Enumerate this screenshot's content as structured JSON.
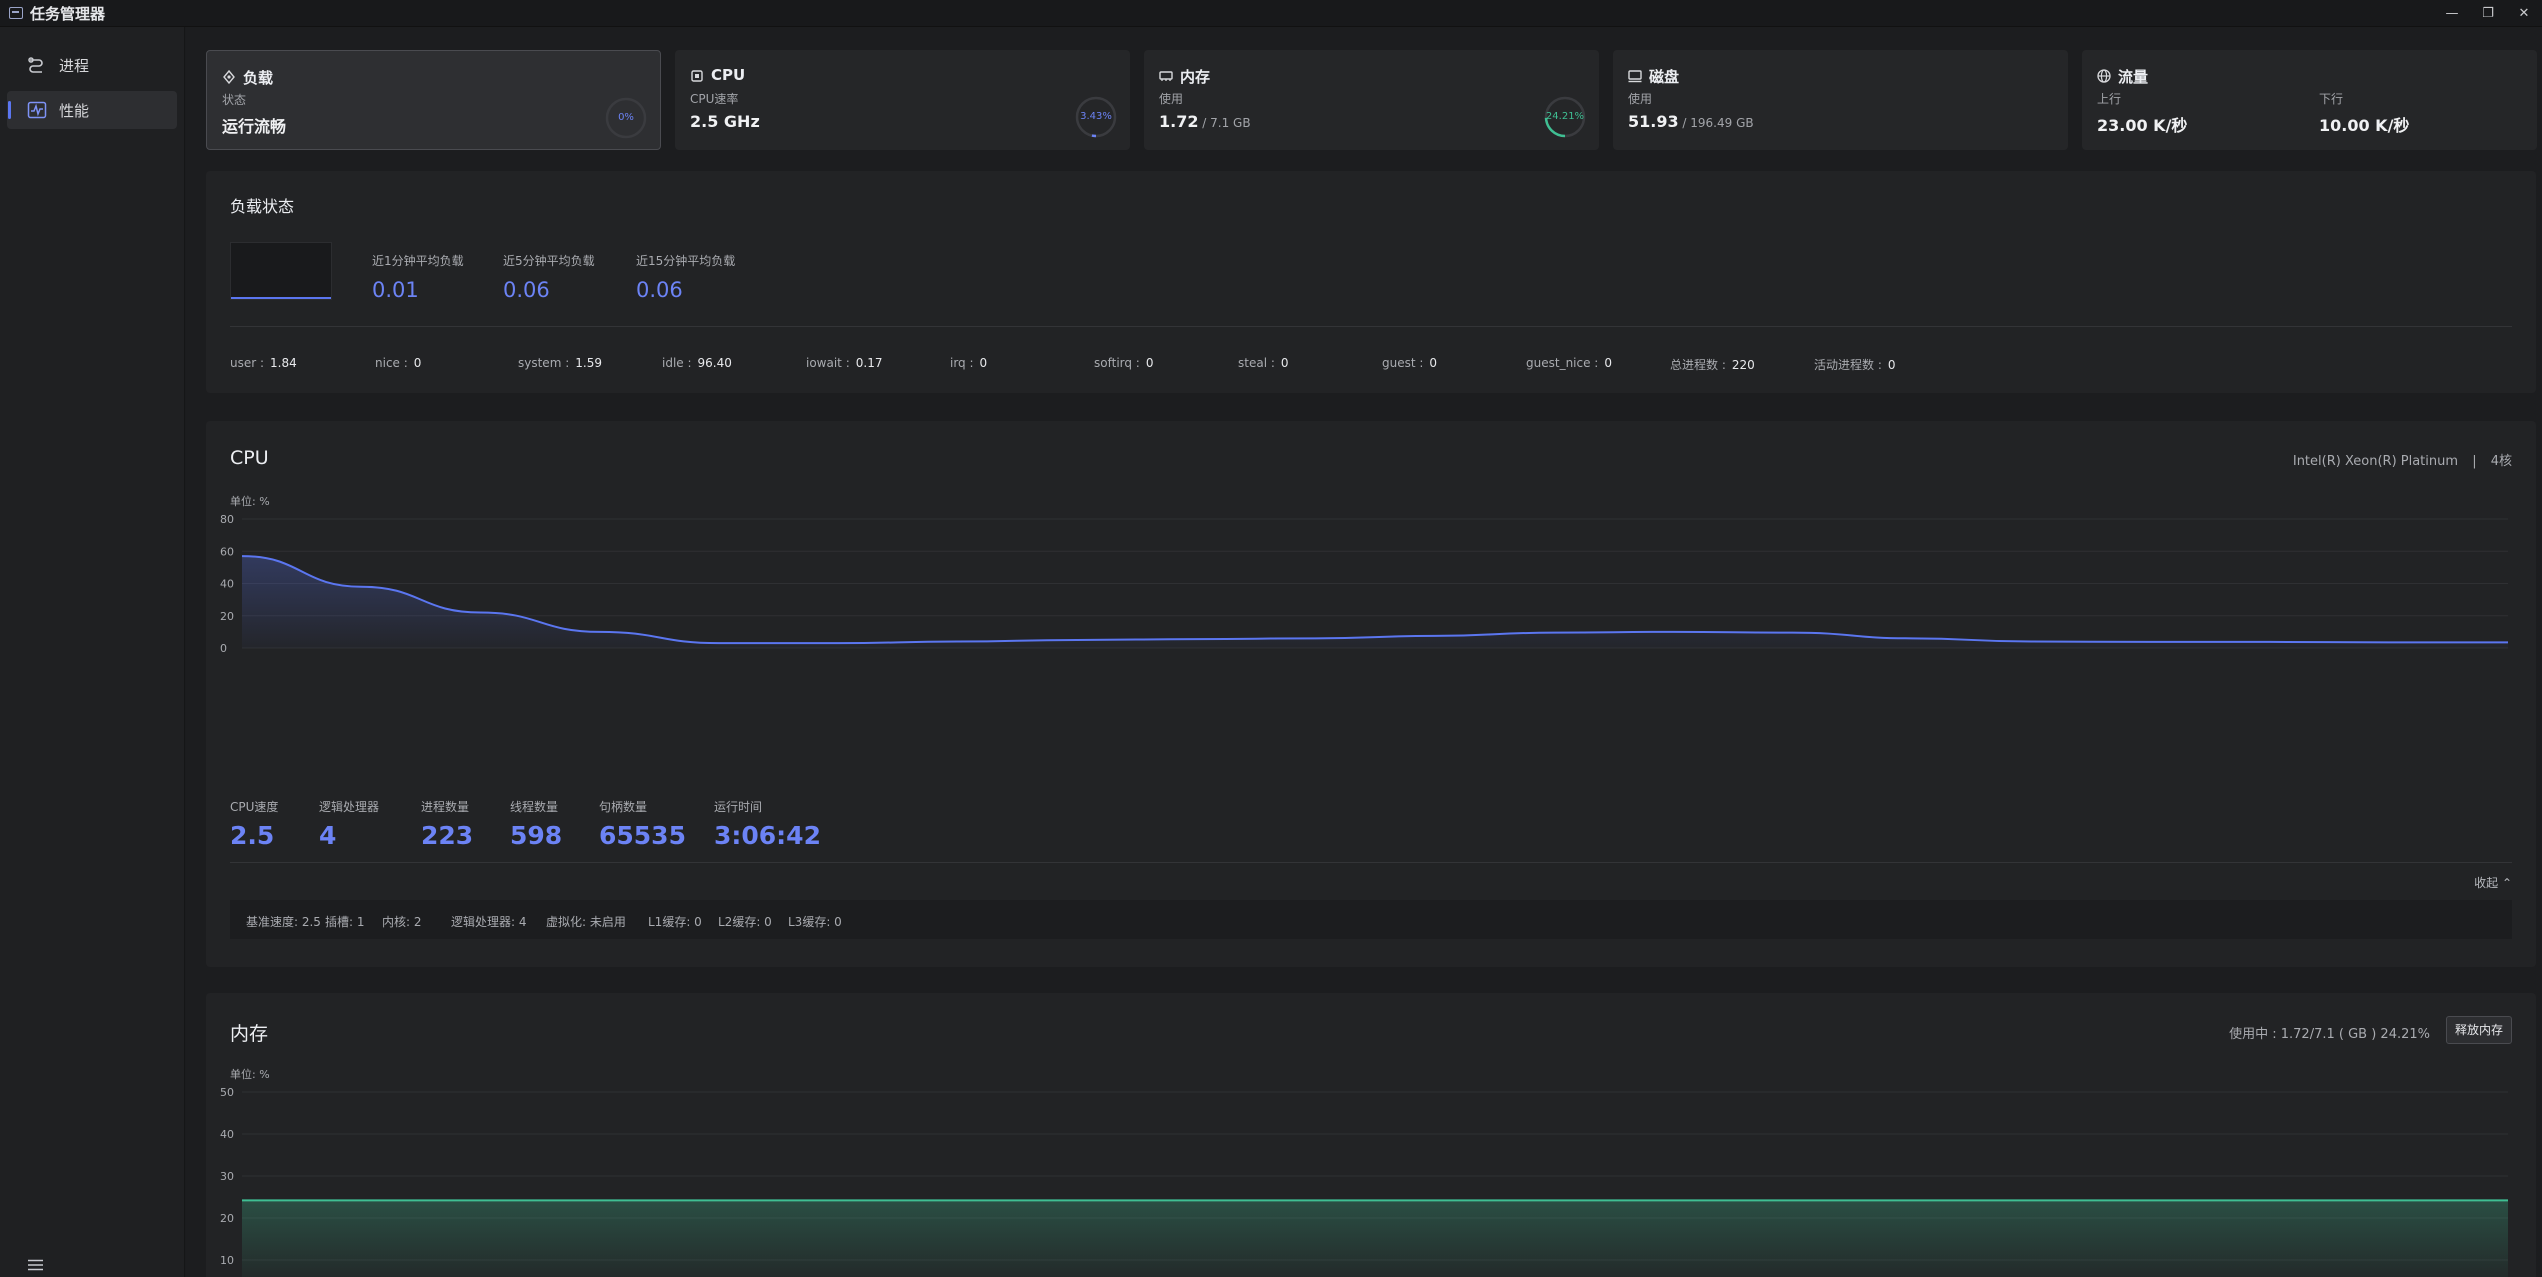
{
  "window": {
    "title": "任务管理器",
    "controls": [
      "—",
      "❐",
      "✕"
    ]
  },
  "sidebar": {
    "items": [
      {
        "label": "进程",
        "icon": "process-icon",
        "active": false
      },
      {
        "label": "性能",
        "icon": "performance-icon",
        "active": true
      }
    ],
    "menu_icon": "menu-icon"
  },
  "cards": {
    "load": {
      "title": "负载",
      "sub": "状态",
      "value": "运行流畅",
      "ring": "0%",
      "ring_color": "#6c83f5",
      "ring_fraction": 0
    },
    "cpu": {
      "title": "CPU",
      "sub": "CPU速率",
      "value": "2.5 GHz",
      "ring": "3.43%",
      "ring_color": "#6c83f5",
      "ring_fraction": 0.0343
    },
    "memory": {
      "title": "内存",
      "sub": "使用",
      "value": "1.72",
      "value_small": " / 7.1 GB",
      "ring": "24.21%",
      "ring_color": "#3fbf93",
      "ring_fraction": 0.2421
    },
    "disk": {
      "title": "磁盘",
      "sub": "使用",
      "value": "51.93",
      "value_small": " / 196.49 GB"
    },
    "network": {
      "title": "流量",
      "up_label": "上行",
      "up_value": "23.00 K/秒",
      "down_label": "下行",
      "down_value": "10.00 K/秒"
    }
  },
  "load_section": {
    "title": "负载状态",
    "stats": [
      {
        "label": "近1分钟平均负载",
        "value": "0.01"
      },
      {
        "label": "近5分钟平均负载",
        "value": "0.06"
      },
      {
        "label": "近15分钟平均负载",
        "value": "0.06"
      }
    ],
    "kv": [
      {
        "k": "user :",
        "v": "1.84"
      },
      {
        "k": "nice :",
        "v": "0"
      },
      {
        "k": "system :",
        "v": "1.59"
      },
      {
        "k": "idle :",
        "v": "96.40"
      },
      {
        "k": "iowait :",
        "v": "0.17"
      },
      {
        "k": "irq :",
        "v": "0"
      },
      {
        "k": "softirq :",
        "v": "0"
      },
      {
        "k": "steal :",
        "v": "0"
      },
      {
        "k": "guest :",
        "v": "0"
      },
      {
        "k": "guest_nice :",
        "v": "0"
      },
      {
        "k": "总进程数 :",
        "v": "220"
      },
      {
        "k": "活动进程数 :",
        "v": "0"
      }
    ]
  },
  "cpu_section": {
    "title": "CPU",
    "model": "Intel(R) Xeon(R) Platinum",
    "separator": "|",
    "cores": "4核",
    "unit": "单位:  %",
    "stats": [
      {
        "label": "CPU速度",
        "value": "2.5"
      },
      {
        "label": "逻辑处理器",
        "value": "4"
      },
      {
        "label": "进程数量",
        "value": "223"
      },
      {
        "label": "线程数量",
        "value": "598"
      },
      {
        "label": "句柄数量",
        "value": "65535"
      },
      {
        "label": "运行时间",
        "value": "3:06:42"
      }
    ],
    "collapse": "收起 ⌃",
    "details": [
      "基准速度: 2.5",
      "插槽: 1",
      "内核: 2",
      "逻辑处理器: 4",
      "虚拟化: 未启用",
      "L1缓存: 0",
      "L2缓存: 0",
      "L3缓存: 0"
    ]
  },
  "memory_section": {
    "title": "内存",
    "usage": "使用中 : 1.72/7.1 ( GB ) 24.21%",
    "release_button": "释放内存",
    "unit": "单位:  %"
  },
  "chart_data": [
    {
      "type": "area",
      "title": "CPU",
      "ylabel": "单位: %",
      "ylim": [
        0,
        80
      ],
      "yticks": [
        "0",
        "20",
        "40",
        "60",
        "80"
      ],
      "grid": true,
      "color": "#5b76f0",
      "series": [
        {
          "values": [
            57,
            38,
            22,
            10,
            3,
            3,
            4,
            5,
            5.5,
            6,
            7.5,
            9.5,
            10,
            9.5,
            6,
            4,
            3.8,
            3.8,
            3.5,
            3.5
          ]
        }
      ]
    },
    {
      "type": "area",
      "title": "内存",
      "ylabel": "单位: %",
      "ylim": [
        0,
        50
      ],
      "yticks": [
        "10",
        "20",
        "30",
        "40",
        "50"
      ],
      "grid": true,
      "color": "#3fbf93",
      "series": [
        {
          "values": [
            24.2,
            24.2,
            24.2,
            24.2,
            24.2,
            24.2,
            24.2,
            24.2,
            24.2,
            24.2,
            24.21,
            24.21,
            24.21,
            24.21,
            24.21,
            24.21,
            24.21,
            24.21,
            24.21,
            24.21
          ]
        }
      ]
    }
  ]
}
